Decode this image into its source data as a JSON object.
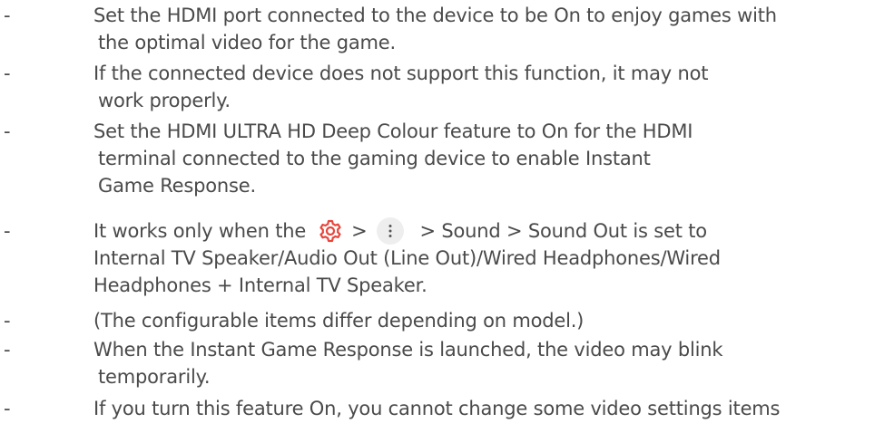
{
  "colors": {
    "text": "#4a4a4a",
    "settings_icon": "#e8453c",
    "more_icon_bg": "#eeeeee"
  },
  "bullet": "-",
  "items": [
    {
      "lines": [
        "Set the HDMI port connected to the device to be On to enjoy games with",
        "the optimal video for the game."
      ]
    },
    {
      "lines": [
        "If the connected device does not support this function, it may not",
        "work properly."
      ]
    },
    {
      "lines": [
        "Set the HDMI ULTRA HD Deep Colour feature to On for the HDMI",
        "terminal connected to the gaming device to enable Instant",
        "Game Response."
      ]
    },
    {
      "prefix": "It works only when the",
      "icons": [
        "settings-gear-icon",
        "more-options-icon"
      ],
      "sep": ">",
      "suffix": "> Sound > Sound Out is set to",
      "lines": [
        "Internal TV Speaker/Audio Out (Line Out)/Wired Headphones/Wired",
        "Headphones + Internal TV Speaker."
      ]
    },
    {
      "lines": [
        "(The configurable items differ depending on model.)"
      ]
    },
    {
      "lines": [
        "When the Instant Game Response is launched, the video may blink",
        "temporarily."
      ]
    },
    {
      "lines": [
        "If you turn this feature On, you cannot change some video settings items"
      ]
    }
  ]
}
